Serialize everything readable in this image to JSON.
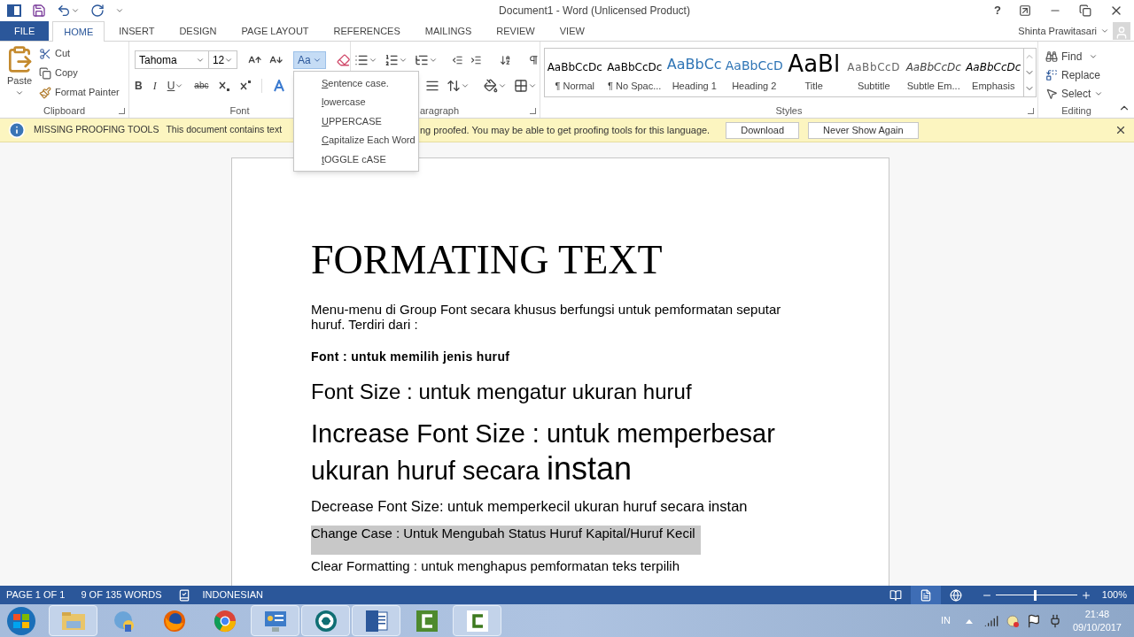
{
  "window": {
    "title": "Document1 - Word (Unlicensed Product)",
    "help": "?",
    "user": "Shinta Prawitasari"
  },
  "tabs": [
    {
      "label": "FILE",
      "kind": "file",
      "selected": false
    },
    {
      "label": "HOME",
      "kind": "tab",
      "selected": true
    },
    {
      "label": "INSERT",
      "kind": "tab",
      "selected": false
    },
    {
      "label": "DESIGN",
      "kind": "tab",
      "selected": false
    },
    {
      "label": "PAGE LAYOUT",
      "kind": "tab",
      "selected": false
    },
    {
      "label": "REFERENCES",
      "kind": "tab",
      "selected": false
    },
    {
      "label": "MAILINGS",
      "kind": "tab",
      "selected": false
    },
    {
      "label": "REVIEW",
      "kind": "tab",
      "selected": false
    },
    {
      "label": "VIEW",
      "kind": "tab",
      "selected": false
    }
  ],
  "clipboard": {
    "paste": "Paste",
    "cut": "Cut",
    "copy": "Copy",
    "format_painter": "Format Painter",
    "label": "Clipboard"
  },
  "font": {
    "name": "Tahoma",
    "size": "12",
    "change_case": {
      "label": "Aa",
      "open": true
    },
    "bold": "B",
    "italic": "I",
    "underline": "U",
    "strikethrough": "abc",
    "label": "Font"
  },
  "paragraph": {
    "label": "aragraph"
  },
  "styles": {
    "items": [
      {
        "preview": "AaBbCcDc",
        "name": "¶ Normal",
        "kind": "normal"
      },
      {
        "preview": "AaBbCcDc",
        "name": "¶ No Spac...",
        "kind": "normal"
      },
      {
        "preview": "AaBbCc",
        "name": "Heading 1",
        "kind": "heading1"
      },
      {
        "preview": "AaBbCcD",
        "name": "Heading 2",
        "kind": "heading2"
      },
      {
        "preview": "AaBl",
        "name": "Title",
        "kind": "title"
      },
      {
        "preview": "AaBbCcD",
        "name": "Subtitle",
        "kind": "subtitle"
      },
      {
        "preview": "AaBbCcDc",
        "name": "Subtle Em...",
        "kind": "subtle"
      },
      {
        "preview": "AaBbCcDc",
        "name": "Emphasis",
        "kind": "emphasis"
      }
    ],
    "label": "Styles"
  },
  "editing": {
    "find": "Find",
    "replace": "Replace",
    "select": "Select",
    "label": "Editing"
  },
  "case_menu": [
    "Sentence case.",
    "lowercase",
    "UPPERCASE",
    "Capitalize Each Word",
    "tOGGLE cASE"
  ],
  "infobar": {
    "title": "MISSING PROOFING TOOLS",
    "message_start": "This document contains text",
    "message_end": "ng proofed. You may be able to get proofing tools for this language.",
    "buttons": [
      "Download",
      "Never Show Again"
    ]
  },
  "document": [
    {
      "kind": "title",
      "text": "FORMATING TEXT",
      "selected": false
    },
    {
      "kind": "body",
      "text": "Menu-menu di Group Font secara khusus berfungsi untuk pemformatan seputar huruf. Terdiri dari :",
      "selected": false
    },
    {
      "kind": "strong",
      "text": "Font : untuk memilih jenis huruf",
      "selected": false
    },
    {
      "kind": "medium",
      "text": "Font Size : untuk mengatur ukuran huruf",
      "selected": false
    },
    {
      "kind": "large",
      "runs": [
        {
          "text": "Increase Font Size : untuk memperbesar ukuran huruf secara ",
          "kind": "normal"
        },
        {
          "text": "instan",
          "kind": "big"
        }
      ],
      "selected": false
    },
    {
      "kind": "small",
      "text": "Decrease Font Size: untuk memperkecil ukuran huruf secara instan",
      "selected": false
    },
    {
      "kind": "body",
      "text": "Change Case : Untuk Mengubah Status Huruf Kapital/Huruf Kecil",
      "selected": true
    },
    {
      "kind": "body",
      "text": "Clear Formatting : untuk menghapus pemformatan teks terpilih",
      "selected": false
    }
  ],
  "status_bar": {
    "page": "PAGE 1 OF 1",
    "words": "9 OF 135 WORDS",
    "language": "INDONESIAN",
    "zoom": "100%",
    "zoom_slider": {
      "level": 0.48
    },
    "views": [
      {
        "kind": "read",
        "selected": false
      },
      {
        "kind": "print",
        "selected": true
      },
      {
        "kind": "web",
        "selected": false
      }
    ]
  },
  "taskbar": {
    "language": "IN",
    "time": "21:48",
    "date": "09/10/2017"
  }
}
